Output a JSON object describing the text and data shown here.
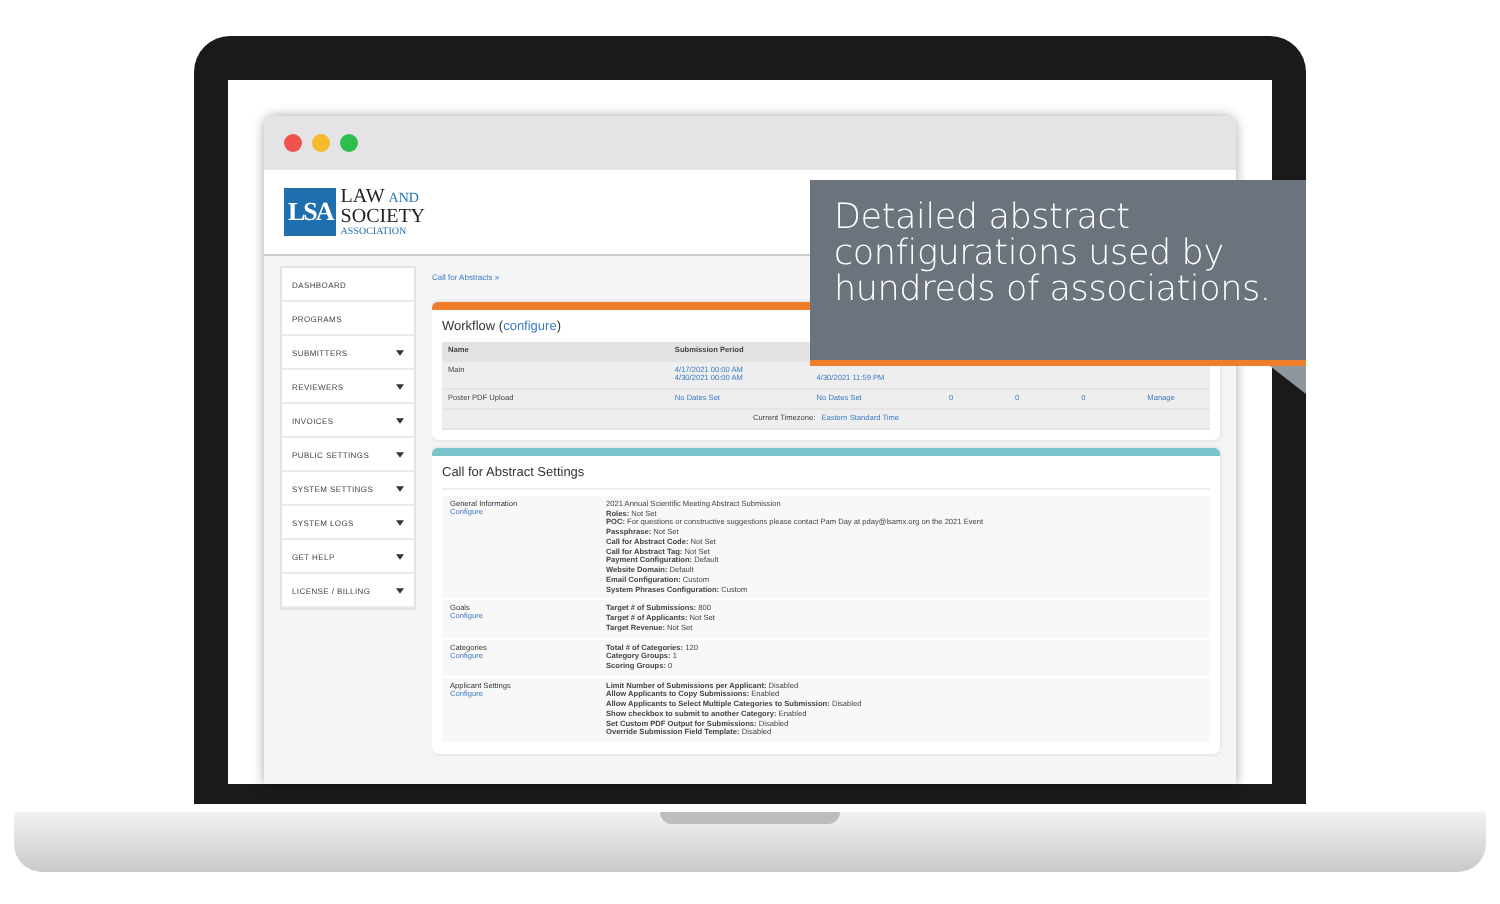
{
  "logo": {
    "mark": "LSA",
    "lines": [
      "LAW",
      "AND",
      "SOCIETY",
      "ASSOCIATION"
    ]
  },
  "sidebar": {
    "items": [
      {
        "label": "DASHBOARD",
        "expandable": false
      },
      {
        "label": "PROGRAMS",
        "expandable": false
      },
      {
        "label": "SUBMITTERS",
        "expandable": true
      },
      {
        "label": "REVIEWERS",
        "expandable": true
      },
      {
        "label": "INVOICES",
        "expandable": true
      },
      {
        "label": "PUBLIC SETTINGS",
        "expandable": true
      },
      {
        "label": "SYSTEM SETTINGS",
        "expandable": true
      },
      {
        "label": "SYSTEM LOGS",
        "expandable": true
      },
      {
        "label": "GET HELP",
        "expandable": true
      },
      {
        "label": "LICENSE / BILLING",
        "expandable": true
      }
    ]
  },
  "breadcrumb": "Call for Abstracts »",
  "workflow": {
    "title": "Workflow (",
    "configure_link": "configure",
    "title_end": ")",
    "columns": [
      "Name",
      "Submission Period"
    ],
    "rows": [
      {
        "cells": [
          {
            "lines": [
              "Main"
            ],
            "link": false
          },
          {
            "lines": [
              "4/17/2021 00:00 AM",
              "4/30/2021 00:00 AM"
            ],
            "link": true
          },
          {
            "lines": [
              "4/30/2021 11:59 PM"
            ],
            "link": true
          }
        ]
      },
      {
        "cells": [
          {
            "lines": [
              "Poster PDF Upload"
            ],
            "link": false
          },
          {
            "lines": [
              "No Dates Set"
            ],
            "link": true
          },
          {
            "lines": [
              "No Dates Set"
            ],
            "link": true
          },
          {
            "lines": [
              "0"
            ],
            "link": true
          },
          {
            "lines": [
              "0"
            ],
            "link": true
          },
          {
            "lines": [
              "0"
            ],
            "link": true
          },
          {
            "lines": [
              "Manage"
            ],
            "link": true
          }
        ]
      }
    ],
    "timezone_label": "Current Timezone:",
    "timezone": "Eastern Standard Time"
  },
  "settings": {
    "title": "Call for Abstract Settings",
    "sections": [
      {
        "name": "General Information",
        "link": "Configure",
        "lines": [
          "2021 Annual Scientific Meeting Abstract Submission",
          "**Roles:** Not Set",
          "**POC:** For questions or constructive suggestions please contact Pam Day at pday@lsamx.org on the 2021 Event",
          "**Passphrase:** Not Set",
          "**Call for Abstract Code:** Not Set",
          "**Call for Abstract Tag:** Not Set",
          "**Payment Configuration:** Default",
          "**Website Domain:** Default",
          "**Email Configuration:** Custom",
          "**System Phrases Configuration:** Custom"
        ]
      },
      {
        "name": "Goals",
        "link": "Configure",
        "lines": [
          "**Target # of Submissions:** 800",
          "**Target # of Applicants:** Not Set",
          "**Target Revenue:** Not Set"
        ]
      },
      {
        "name": "Categories",
        "link": "Configure",
        "lines": [
          "**Total # of Categories:** 120",
          "**Category Groups:** 1",
          "**Scoring Groups:** 0"
        ]
      },
      {
        "name": "Applicant Settings",
        "link": "Configure",
        "lines": [
          "**Limit Number of Submissions per Applicant:** Disabled",
          "**Allow Applicants to Copy Submissions:** Enabled",
          "**Allow Applicants to Select Multiple Categories to Submission:** Disabled",
          "**Show checkbox to submit to another Category:** Enabled",
          "**Set Custom PDF Output for Submissions:** Disabled",
          "**Override Submission Field Template:** Disabled"
        ]
      }
    ]
  },
  "callout": {
    "text": "Detailed abstract configurations used by hundreds of associations."
  }
}
